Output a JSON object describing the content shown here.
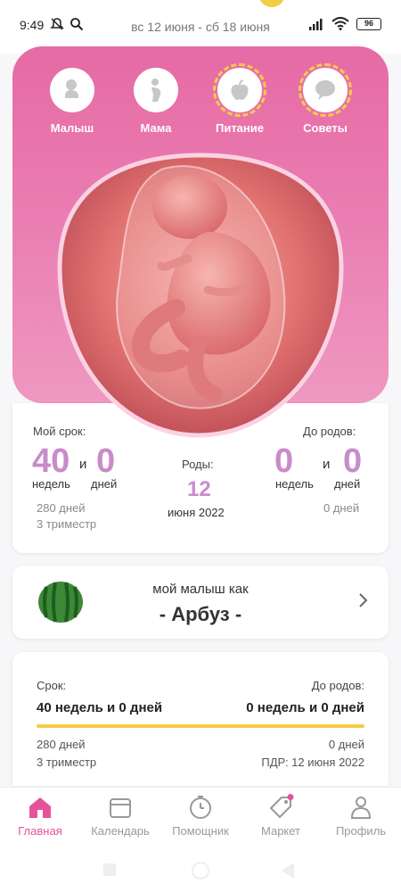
{
  "status": {
    "time": "9:49",
    "battery": "96",
    "date_range": "вс 12 июня - сб 18 июня"
  },
  "colors": {
    "accent": "#e6529b",
    "pink": "#e66aa5",
    "lilac": "#c98bc9",
    "yellow": "#f5cc45"
  },
  "hero_icons": [
    {
      "label": "Малыш",
      "icon": "baby-icon"
    },
    {
      "label": "Мама",
      "icon": "pregnant-mother-icon"
    },
    {
      "label": "Питание",
      "icon": "apple-icon"
    },
    {
      "label": "Советы",
      "icon": "chat-bubble-icon"
    }
  ],
  "info": {
    "my_term_label": "Мой срок:",
    "weeks": "40",
    "and": "и",
    "days": "0",
    "weeks_label": "недель",
    "days_label": "дней",
    "total_days": "280 дней",
    "trimester": "3 триместр",
    "birth_label": "Роды:",
    "birth_day": "12",
    "birth_month_year": "июня 2022",
    "until_birth_label": "До родов:",
    "until_weeks": "0",
    "until_days": "0",
    "until_total_days": "0 дней"
  },
  "fruit": {
    "title": "мой малыш как",
    "name": "- Арбуз -"
  },
  "term": {
    "term_label": "Срок:",
    "term_value": "40 недель и 0 дней",
    "until_label": "До родов:",
    "until_value": "0 недель и 0 дней",
    "progress": 1.0,
    "days": "280 дней",
    "trimester": "3 триместр",
    "right_days": "0 дней",
    "due_date": "ПДР: 12 июня 2022"
  },
  "nav": [
    {
      "label": "Главная",
      "icon": "home-icon",
      "active": true
    },
    {
      "label": "Календарь",
      "icon": "calendar-icon",
      "active": false
    },
    {
      "label": "Помощник",
      "icon": "timer-icon",
      "active": false
    },
    {
      "label": "Маркет",
      "icon": "tag-icon",
      "active": false
    },
    {
      "label": "Профиль",
      "icon": "profile-icon",
      "active": false
    }
  ]
}
